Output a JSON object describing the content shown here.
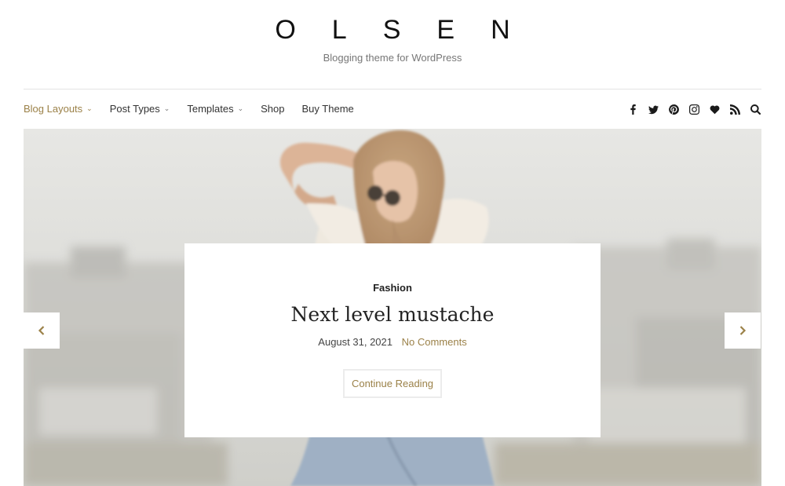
{
  "header": {
    "site_title": "OLSEN",
    "tagline": "Blogging theme for WordPress"
  },
  "nav": {
    "items": [
      {
        "label": "Blog Layouts",
        "active": true,
        "has_dropdown": true
      },
      {
        "label": "Post Types",
        "active": false,
        "has_dropdown": true
      },
      {
        "label": "Templates",
        "active": false,
        "has_dropdown": true
      },
      {
        "label": "Shop",
        "active": false,
        "has_dropdown": false
      },
      {
        "label": "Buy Theme",
        "active": false,
        "has_dropdown": false
      }
    ],
    "dropdown_icon": "chevron-down-icon"
  },
  "social": {
    "icons": [
      "facebook-icon",
      "twitter-icon",
      "pinterest-icon",
      "instagram-icon",
      "bloglovin-heart-icon",
      "rss-icon",
      "search-icon"
    ]
  },
  "slider": {
    "category": "Fashion",
    "title": "Next level mustache",
    "date": "August 31, 2021",
    "comments": "No Comments",
    "button_label": "Continue Reading",
    "prev_icon": "chevron-left-icon",
    "next_icon": "chevron-right-icon"
  },
  "colors": {
    "accent": "#9b8148",
    "text": "#222222",
    "muted": "#777777",
    "rule": "#e3e3e3"
  }
}
